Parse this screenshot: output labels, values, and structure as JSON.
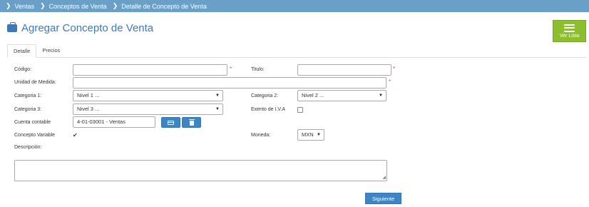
{
  "breadcrumb": [
    "Ventas",
    "Conceptos de Venta",
    "Detalle de Concepto de Venta"
  ],
  "title": "Agregar Concepto de Venta",
  "list_button": "Ver Lista",
  "tabs": [
    "Detalle",
    "Precios"
  ],
  "form": {
    "codigo": {
      "label": "Código:",
      "value": ""
    },
    "titulo": {
      "label": "Titulo:",
      "value": ""
    },
    "unidad": {
      "label": "Unidad de Medida:",
      "value": ""
    },
    "categoria1": {
      "label": "Categoria 1:",
      "value": "Nivel 1 ..."
    },
    "categoria2": {
      "label": "Categoria 2:",
      "value": "Nivel 2 ..."
    },
    "categoria3": {
      "label": "Categoria 3:",
      "value": "Nivel 3 ..."
    },
    "exento": {
      "label": "Exento de I.V.A",
      "checked": false
    },
    "cuenta": {
      "label": "Cuenta contable",
      "value": "4-01-03001 - Ventas"
    },
    "concepto_variable": {
      "label": "Concepto Variable",
      "checked": true
    },
    "moneda": {
      "label": "Moneda:",
      "value": "MXN"
    },
    "descripcion": {
      "label": "Descripción:",
      "value": ""
    },
    "required_mark": "*"
  },
  "next_button": "Siguiente",
  "colors": {
    "breadcrumb_bg": "#6a9fc8",
    "title": "#3d7ab5",
    "list_button": "#8cbe30",
    "primary_button": "#3d85c6",
    "required": "#e05050"
  }
}
